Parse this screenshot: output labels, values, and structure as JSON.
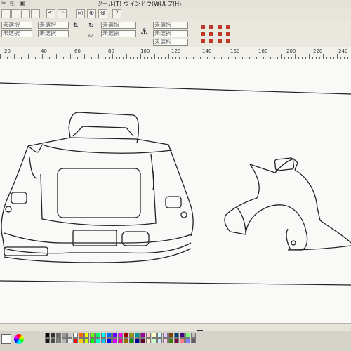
{
  "menu": {
    "items": [
      "ツール(T)",
      "ウインドウ(W)",
      "ヘルプ(H)"
    ]
  },
  "propbar": {
    "field_text": "未選択",
    "help_icon_text": "?"
  },
  "ruler": {
    "labels": [
      "20",
      "40",
      "60",
      "80",
      "100",
      "120",
      "140",
      "160",
      "180",
      "200",
      "220",
      "240"
    ]
  },
  "toolbar": {
    "icons": [
      "scissors-icon",
      "copy-icon",
      "paste-icon",
      "undo-icon",
      "redo-icon",
      "zoom-icon",
      "group-icon",
      "ungroup-icon",
      "help-icon"
    ]
  },
  "palette": {
    "colors": [
      "#000000",
      "#1a1a1a",
      "#333333",
      "#4d4d4d",
      "#666666",
      "#808080",
      "#999999",
      "#b3b3b3",
      "#cccccc",
      "#e6e6e6",
      "#ffffff",
      "#ff0000",
      "#ff6600",
      "#ffcc00",
      "#ffff00",
      "#ccff00",
      "#66ff00",
      "#00ff00",
      "#00ff66",
      "#00ffcc",
      "#00ffff",
      "#00ccff",
      "#0066ff",
      "#0000ff",
      "#6600ff",
      "#cc00ff",
      "#ff00ff",
      "#ff0099",
      "#990000",
      "#996600",
      "#999900",
      "#009900",
      "#009999",
      "#000099",
      "#990099",
      "#660033",
      "#ffcccc",
      "#ffe5cc",
      "#ffffcc",
      "#ccffcc",
      "#ccffff",
      "#cce5ff",
      "#e5ccff",
      "#ffcce5",
      "#804000",
      "#408000",
      "#004080",
      "#800040",
      "#400080",
      "#ff8080",
      "#80ff80",
      "#8080ff",
      "#c0c0c0",
      "#606060"
    ]
  }
}
